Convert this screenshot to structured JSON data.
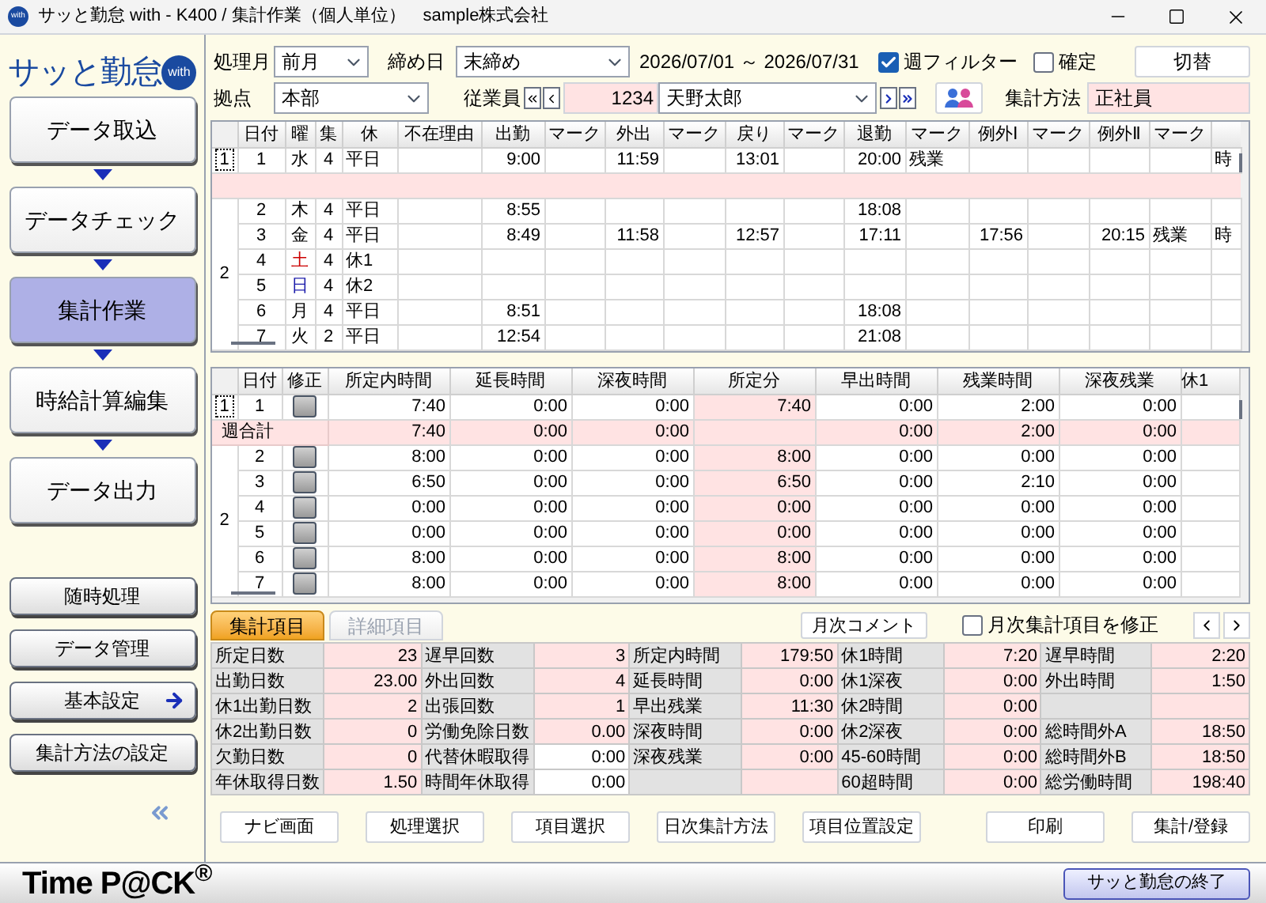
{
  "window": {
    "app_badge": "with",
    "title": "サッと勤怠 with - K400 / 集計作業（個人単位）　sample株式会社"
  },
  "sidebar": {
    "logo": "サッと勤怠",
    "logo_badge": "with",
    "steps": [
      {
        "label": "データ取込",
        "selected": false
      },
      {
        "label": "データチェック",
        "selected": false
      },
      {
        "label": "集計作業",
        "selected": true
      },
      {
        "label": "時給計算編集",
        "selected": false
      },
      {
        "label": "データ出力",
        "selected": false
      }
    ],
    "buttons": [
      {
        "label": "随時処理",
        "kind": "plain"
      },
      {
        "label": "データ管理",
        "kind": "plain"
      },
      {
        "label": "基本設定",
        "kind": "arrow"
      },
      {
        "label": "集計方法の設定",
        "kind": "plain"
      }
    ]
  },
  "filters": {
    "month": {
      "label": "処理月",
      "value": "前月"
    },
    "closing": {
      "label": "締め日",
      "value": "末締め"
    },
    "period": "2026/07/01 ～ 2026/07/31",
    "week_filter": {
      "label": "週フィルター",
      "checked": true
    },
    "confirmed": {
      "label": "確定",
      "checked": false
    },
    "switch_button": "切替",
    "site": {
      "label": "拠点",
      "value": "本部"
    },
    "employee": {
      "label": "従業員",
      "code": "1234",
      "name": "天野太郎"
    },
    "method": {
      "label": "集計方法",
      "value": "正社員"
    }
  },
  "daily_table": {
    "columns": [
      "日付",
      "曜",
      "集",
      "休",
      "不在理由",
      "出勤",
      "マーク",
      "外出",
      "マーク",
      "戻り",
      "マーク",
      "退勤",
      "マーク",
      "例外Ⅰ",
      "マーク",
      "例外Ⅱ",
      "マーク"
    ],
    "rows": [
      {
        "kind": "day",
        "week": "1",
        "focused": true,
        "color": "#000000",
        "cells": [
          "1",
          "水",
          "4",
          "平日",
          null,
          "9:00",
          null,
          "11:59",
          null,
          "13:01",
          null,
          "20:00",
          "残業",
          null,
          null,
          null,
          null,
          "時"
        ]
      },
      {
        "kind": "total"
      },
      {
        "kind": "day",
        "week": "2",
        "focused": false,
        "color": "#000000",
        "cells": [
          "2",
          "木",
          "4",
          "平日",
          null,
          "8:55",
          null,
          null,
          null,
          null,
          null,
          "18:08",
          null,
          null,
          null,
          null,
          null,
          null
        ]
      },
      {
        "kind": "day",
        "color": "#000000",
        "cells": [
          "3",
          "金",
          "4",
          "平日",
          null,
          "8:49",
          null,
          "11:58",
          null,
          "12:57",
          null,
          "17:11",
          null,
          "17:56",
          null,
          "20:15",
          "残業",
          "時"
        ]
      },
      {
        "kind": "day",
        "color": "#cc0000",
        "cells": [
          "4",
          "土",
          "4",
          "休1",
          null,
          null,
          null,
          null,
          null,
          null,
          null,
          null,
          null,
          null,
          null,
          null,
          null,
          null
        ]
      },
      {
        "kind": "day",
        "color": "#1a1aaa",
        "cells": [
          "5",
          "日",
          "4",
          "休2",
          null,
          null,
          null,
          null,
          null,
          null,
          null,
          null,
          null,
          null,
          null,
          null,
          null,
          null
        ]
      },
      {
        "kind": "day",
        "color": "#000000",
        "cells": [
          "6",
          "月",
          "4",
          "平日",
          null,
          "8:51",
          null,
          null,
          null,
          null,
          null,
          "18:08",
          null,
          null,
          null,
          null,
          null,
          null
        ]
      },
      {
        "kind": "day",
        "color": "#000000",
        "cells": [
          "7",
          "火",
          "2",
          "平日",
          null,
          "12:54",
          null,
          null,
          null,
          null,
          null,
          "21:08",
          null,
          null,
          null,
          null,
          null,
          null
        ]
      }
    ]
  },
  "totals_table": {
    "columns": [
      {
        "label": "日付",
        "kind": "text"
      },
      {
        "label": "修正",
        "kind": "button"
      },
      {
        "label": "所定内時間",
        "kind": "text"
      },
      {
        "label": "延長時間",
        "kind": "text"
      },
      {
        "label": "深夜時間",
        "kind": "text"
      },
      {
        "label": "所定分",
        "kind": "shaded"
      },
      {
        "label": "早出時間",
        "kind": "text"
      },
      {
        "label": "残業時間",
        "kind": "text"
      },
      {
        "label": "深夜残業",
        "kind": "text"
      },
      {
        "label": "休1",
        "kind": "text"
      }
    ],
    "rows": [
      {
        "kind": "day",
        "week": "1",
        "focused": true,
        "cells": [
          "1",
          null,
          "7:40",
          "0:00",
          "0:00",
          "7:40",
          "0:00",
          "2:00",
          "0:00",
          null
        ]
      },
      {
        "kind": "total",
        "label": "週合計",
        "cells": [
          null,
          null,
          "7:40",
          "0:00",
          "0:00",
          null,
          "0:00",
          "2:00",
          "0:00",
          null
        ]
      },
      {
        "kind": "day",
        "week": "2",
        "focused": false,
        "cells": [
          "2",
          null,
          "8:00",
          "0:00",
          "0:00",
          "8:00",
          "0:00",
          "0:00",
          "0:00",
          null
        ]
      },
      {
        "kind": "day",
        "cells": [
          "3",
          null,
          "6:50",
          "0:00",
          "0:00",
          "6:50",
          "0:00",
          "2:10",
          "0:00",
          null
        ]
      },
      {
        "kind": "day",
        "cells": [
          "4",
          null,
          "0:00",
          "0:00",
          "0:00",
          "0:00",
          "0:00",
          "0:00",
          "0:00",
          null
        ]
      },
      {
        "kind": "day",
        "cells": [
          "5",
          null,
          "0:00",
          "0:00",
          "0:00",
          "0:00",
          "0:00",
          "0:00",
          "0:00",
          null
        ]
      },
      {
        "kind": "day",
        "cells": [
          "6",
          null,
          "8:00",
          "0:00",
          "0:00",
          "8:00",
          "0:00",
          "0:00",
          "0:00",
          null
        ]
      },
      {
        "kind": "day",
        "cells": [
          "7",
          null,
          "8:00",
          "0:00",
          "0:00",
          "8:00",
          "0:00",
          "0:00",
          "0:00",
          null
        ]
      }
    ]
  },
  "summary": {
    "tabs": [
      {
        "label": "集計項目",
        "selected": true
      },
      {
        "label": "詳細項目",
        "selected": false
      }
    ],
    "comment_button": "月次コメント",
    "modify": {
      "label": "月次集計項目を修正",
      "checked": false
    },
    "rows": [
      [
        {
          "label": "所定日数",
          "value": "23",
          "editable": false
        },
        {
          "label": "遅早回数",
          "value": "3",
          "editable": false
        },
        {
          "label": "所定内時間",
          "value": "179:50",
          "editable": false
        },
        {
          "label": "休1時間",
          "value": "7:20",
          "editable": false
        },
        {
          "label": "遅早時間",
          "value": "2:20",
          "editable": false
        }
      ],
      [
        {
          "label": "出勤日数",
          "value": "23.00",
          "editable": false
        },
        {
          "label": "外出回数",
          "value": "4",
          "editable": false
        },
        {
          "label": "延長時間",
          "value": "0:00",
          "editable": false
        },
        {
          "label": "休1深夜",
          "value": "0:00",
          "editable": false
        },
        {
          "label": "外出時間",
          "value": "1:50",
          "editable": false
        }
      ],
      [
        {
          "label": "休1出勤日数",
          "value": "2",
          "editable": false
        },
        {
          "label": "出張回数",
          "value": "1",
          "editable": false
        },
        {
          "label": "早出残業",
          "value": "11:30",
          "editable": false
        },
        {
          "label": "休2時間",
          "value": "0:00",
          "editable": false
        },
        {
          "editable": false
        }
      ],
      [
        {
          "label": "休2出勤日数",
          "value": "0",
          "editable": false
        },
        {
          "label": "労働免除日数",
          "value": "0.00",
          "editable": false
        },
        {
          "label": "深夜時間",
          "value": "0:00",
          "editable": false
        },
        {
          "label": "休2深夜",
          "value": "0:00",
          "editable": false
        },
        {
          "label": "総時間外A",
          "value": "18:50",
          "editable": false
        }
      ],
      [
        {
          "label": "欠勤日数",
          "value": "0",
          "editable": false
        },
        {
          "label": "代替休暇取得",
          "value": "0:00",
          "editable": true
        },
        {
          "label": "深夜残業",
          "value": "0:00",
          "editable": false
        },
        {
          "label": "45-60時間",
          "value": "0:00",
          "editable": false
        },
        {
          "label": "総時間外B",
          "value": "18:50",
          "editable": false
        }
      ],
      [
        {
          "label": "年休取得日数",
          "value": "1.50",
          "editable": false
        },
        {
          "label": "時間年休取得",
          "value": "0:00",
          "editable": true
        },
        {
          "editable": false
        },
        {
          "label": "60超時間",
          "value": "0:00",
          "editable": false
        },
        {
          "label": "総労働時間",
          "value": "198:40",
          "editable": false
        }
      ]
    ]
  },
  "actions": {
    "left": [
      "ナビ画面",
      "処理選択",
      "項目選択",
      "日次集計方法",
      "項目位置設定"
    ],
    "right": [
      "印刷",
      "集計/登録"
    ]
  },
  "footer": {
    "logo": "Time P@CK$^{®}$",
    "exit_button": "サッと勤怠の終了"
  }
}
